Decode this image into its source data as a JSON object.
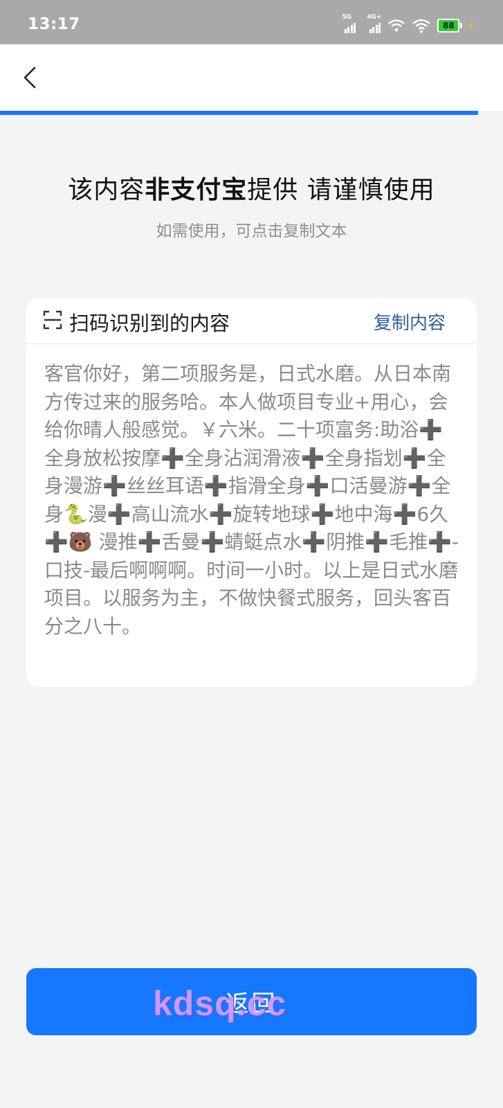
{
  "status_bar": {
    "time": "13:17",
    "signal_1_label": "5G",
    "signal_2_label": "4G+",
    "battery_level": "88",
    "battery_color": "#2ecc2e"
  },
  "nav": {
    "back_icon": "chevron-left-icon",
    "progress_fraction": 0.95,
    "progress_color": "#1677ff"
  },
  "warning": {
    "title_prefix": "该内容",
    "title_emphasis": "非支付宝",
    "title_suffix": "提供 请谨慎使用",
    "subtitle": "如需使用，可点击复制文本"
  },
  "card": {
    "title": "扫码识别到的内容",
    "copy_label": "复制内容",
    "content": "客官你好，第二项服务是，日式水磨。从日本南方传过来的服务哈。本人做项目专业+用心，会给你晴人般感觉。￥六米。二十项富务:助浴➕全身放松按摩➕全身沾润滑液➕全身指划➕全身漫游➕丝丝耳语➕指滑全身➕口活曼游➕全身🐍漫➕高山流水➕旋转地球➕地中海➕6久➕🐻 漫推➕舌曼➕蜻蜓点水➕阴推➕毛推➕-口技-最后啊啊啊。时间一小时。以上是日式水磨项目。以服务为主，不做快餐式服务，回头客百分之八十。"
  },
  "footer": {
    "return_label": "返回",
    "watermark": "kdsq.cc"
  },
  "colors": {
    "accent": "#1677ff",
    "link": "#2d5f9e",
    "background": "#f3f4f6"
  }
}
